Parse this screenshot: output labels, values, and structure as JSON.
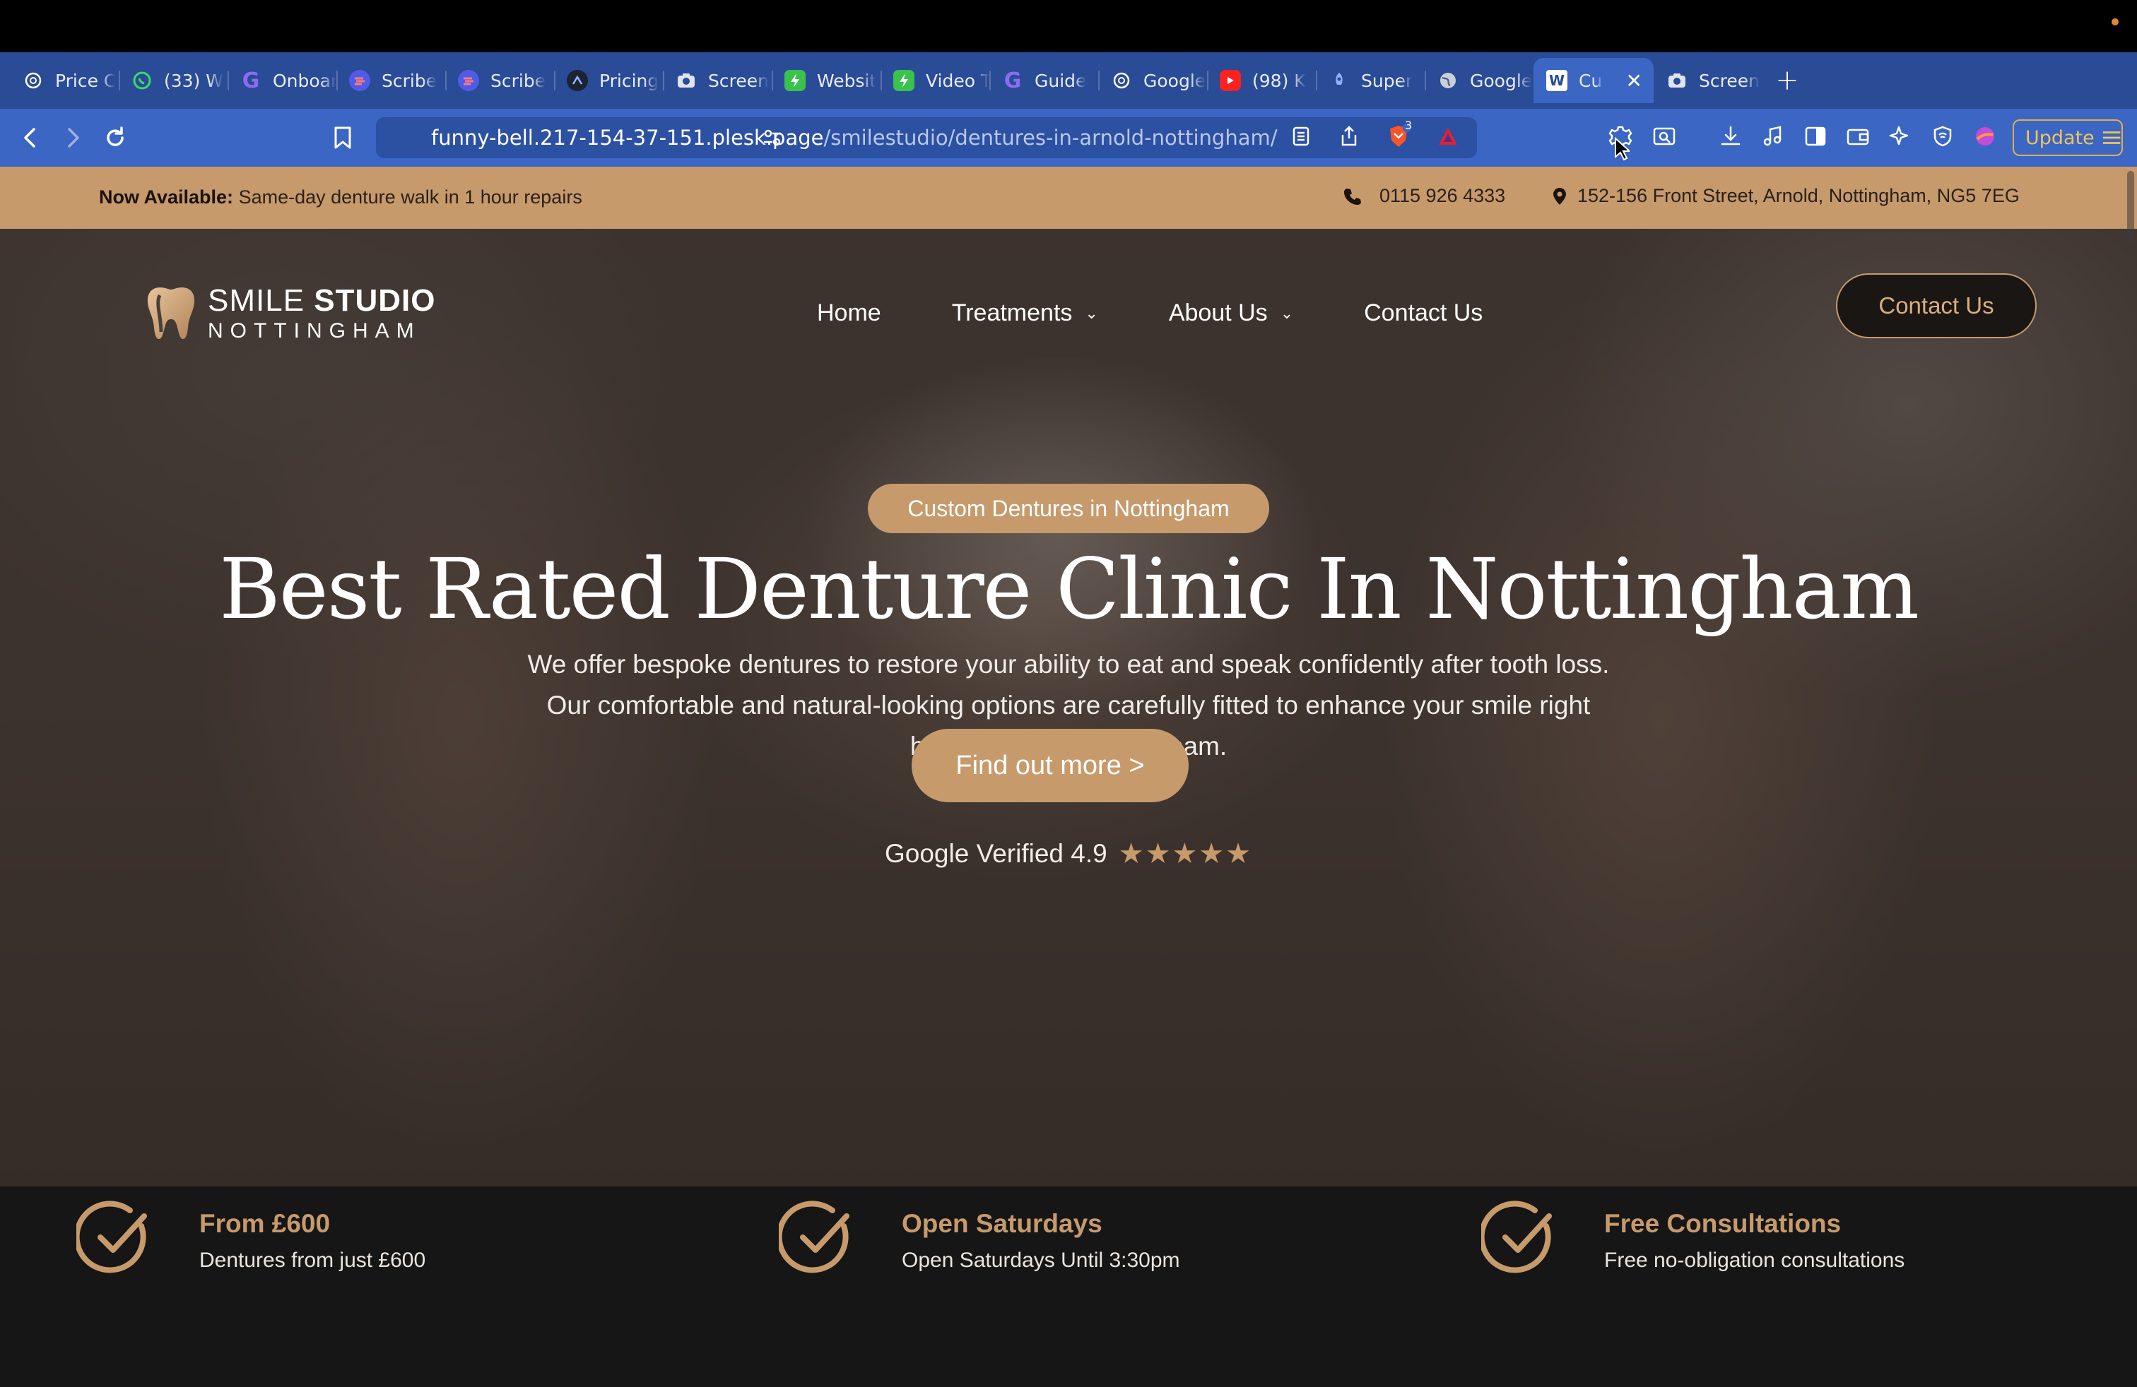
{
  "browser": {
    "tabs": [
      {
        "label": "Price C",
        "icon": "openai-icon"
      },
      {
        "label": "(33) W",
        "icon": "whatsapp-icon"
      },
      {
        "label": "Onboar",
        "icon": "gamma-g-icon"
      },
      {
        "label": "Scribe",
        "icon": "scribe-icon"
      },
      {
        "label": "Scribe",
        "icon": "scribe-icon"
      },
      {
        "label": "Pricing",
        "icon": "pricing-icon"
      },
      {
        "label": "Screen",
        "icon": "camera-icon"
      },
      {
        "label": "Websit",
        "icon": "green-bolt-icon"
      },
      {
        "label": "Video T",
        "icon": "green-bolt-icon"
      },
      {
        "label": "Guide",
        "icon": "gamma-g-icon"
      },
      {
        "label": "Google",
        "icon": "openai-icon"
      },
      {
        "label": "(98) K",
        "icon": "youtube-icon"
      },
      {
        "label": "Super",
        "icon": "rocket-icon"
      },
      {
        "label": "Google",
        "icon": "globe-icon"
      },
      {
        "label": "Cu",
        "icon": "wordpress-icon",
        "active": true
      },
      {
        "label": "Screen",
        "icon": "camera-icon"
      }
    ],
    "url_host": "funny-bell.217-154-37-151.plesk.page",
    "url_path": "/smilestudio/dentures-in-arnold-nottingham/",
    "shields_count": "3",
    "update_label": "Update"
  },
  "announce": {
    "label_bold": "Now Available:",
    "label_text": "Same-day denture walk in 1 hour repairs",
    "phone": "0115 926 4333",
    "address": "152-156 Front Street, Arnold, Nottingham, NG5 7EG"
  },
  "header": {
    "logo_word1": "SMILE",
    "logo_word2": "STUDIO",
    "logo_sub": "NOTTINGHAM",
    "nav": [
      {
        "label": "Home",
        "dropdown": false
      },
      {
        "label": "Treatments",
        "dropdown": true
      },
      {
        "label": "About Us",
        "dropdown": true
      },
      {
        "label": "Contact Us",
        "dropdown": false
      }
    ],
    "cta": "Contact Us"
  },
  "hero": {
    "eyebrow": "Custom Dentures in Nottingham",
    "title": "Best Rated Denture Clinic In Nottingham",
    "body_lines": [
      "We offer bespoke dentures to restore your ability to eat and speak confidently after tooth loss.",
      "Our comfortable and natural-looking options are carefully fitted to enhance your smile right",
      "here in Arnold, Nottingham."
    ],
    "cta": "Find out more >",
    "rating_text": "Google Verified 4.9",
    "stars": "★★★★★"
  },
  "features": [
    {
      "title": "From £600",
      "subtitle": "Dentures from just £600"
    },
    {
      "title": "Open Saturdays",
      "subtitle": "Open Saturdays Until 3:30pm"
    },
    {
      "title": "Free Consultations",
      "subtitle": "Free no-obligation consultations"
    }
  ],
  "colors": {
    "accent": "#c79a6c",
    "browser_chrome": "#3b66c4",
    "dark_bg": "#161616"
  }
}
